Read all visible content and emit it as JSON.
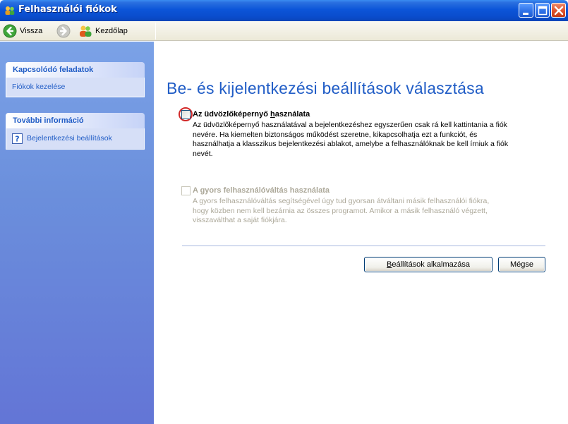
{
  "window": {
    "title": "Felhasználói fiókok",
    "icon": "user-accounts-icon",
    "controls": [
      "minimize-icon",
      "maximize-icon",
      "close-icon"
    ]
  },
  "toolbar": {
    "back_label": "Vissza",
    "home_label": "Kezdőlap"
  },
  "sidebar": {
    "related_tasks": {
      "title": "Kapcsolódó feladatok",
      "items": [
        {
          "label": "Fiókok kezelése"
        }
      ]
    },
    "more_info": {
      "title": "További információ",
      "items": [
        {
          "label": "Bejelentkezési beállítások",
          "icon": "help-icon"
        }
      ]
    }
  },
  "main": {
    "title": "Be- és kijelentkezési beállítások választása",
    "options": [
      {
        "title_prefix": "Az üdvözlőképernyő ",
        "title_accel": "h",
        "title_suffix": "asználata",
        "checked": false,
        "enabled": true,
        "lines": [
          "Az üdvözlőképernyő használatával a bejelentkezéshez egyszerűen csak rá kell kattintania a fiók",
          "nevére. Ha kiemelten biztonságos működést szeretne, kikapcsolhatja ezt a funkciót, és",
          "használhatja a klasszikus bejelentkezési ablakot, amelybe a felhasználóknak be kell írniuk a fiók",
          "nevét."
        ]
      },
      {
        "title": "A gyors felhasználóváltás használata",
        "checked": false,
        "enabled": false,
        "lines": [
          "A gyors felhasználóváltás segítségével úgy tud gyorsan átváltani másik felhasználói fiókra,",
          "hogy közben nem kell bezárnia az összes programot. Amikor a másik felhasználó végzett,",
          "visszaválthat a saját fiókjára."
        ]
      }
    ],
    "apply_accel": "B",
    "apply_rest": "eállítások alkalmazása",
    "cancel_label": "Mégse"
  },
  "colors": {
    "titlebar": "#0c55d8",
    "sidebar": "#6b8fdc",
    "link": "#215dc6",
    "highlight_ring": "#d22a2a"
  }
}
